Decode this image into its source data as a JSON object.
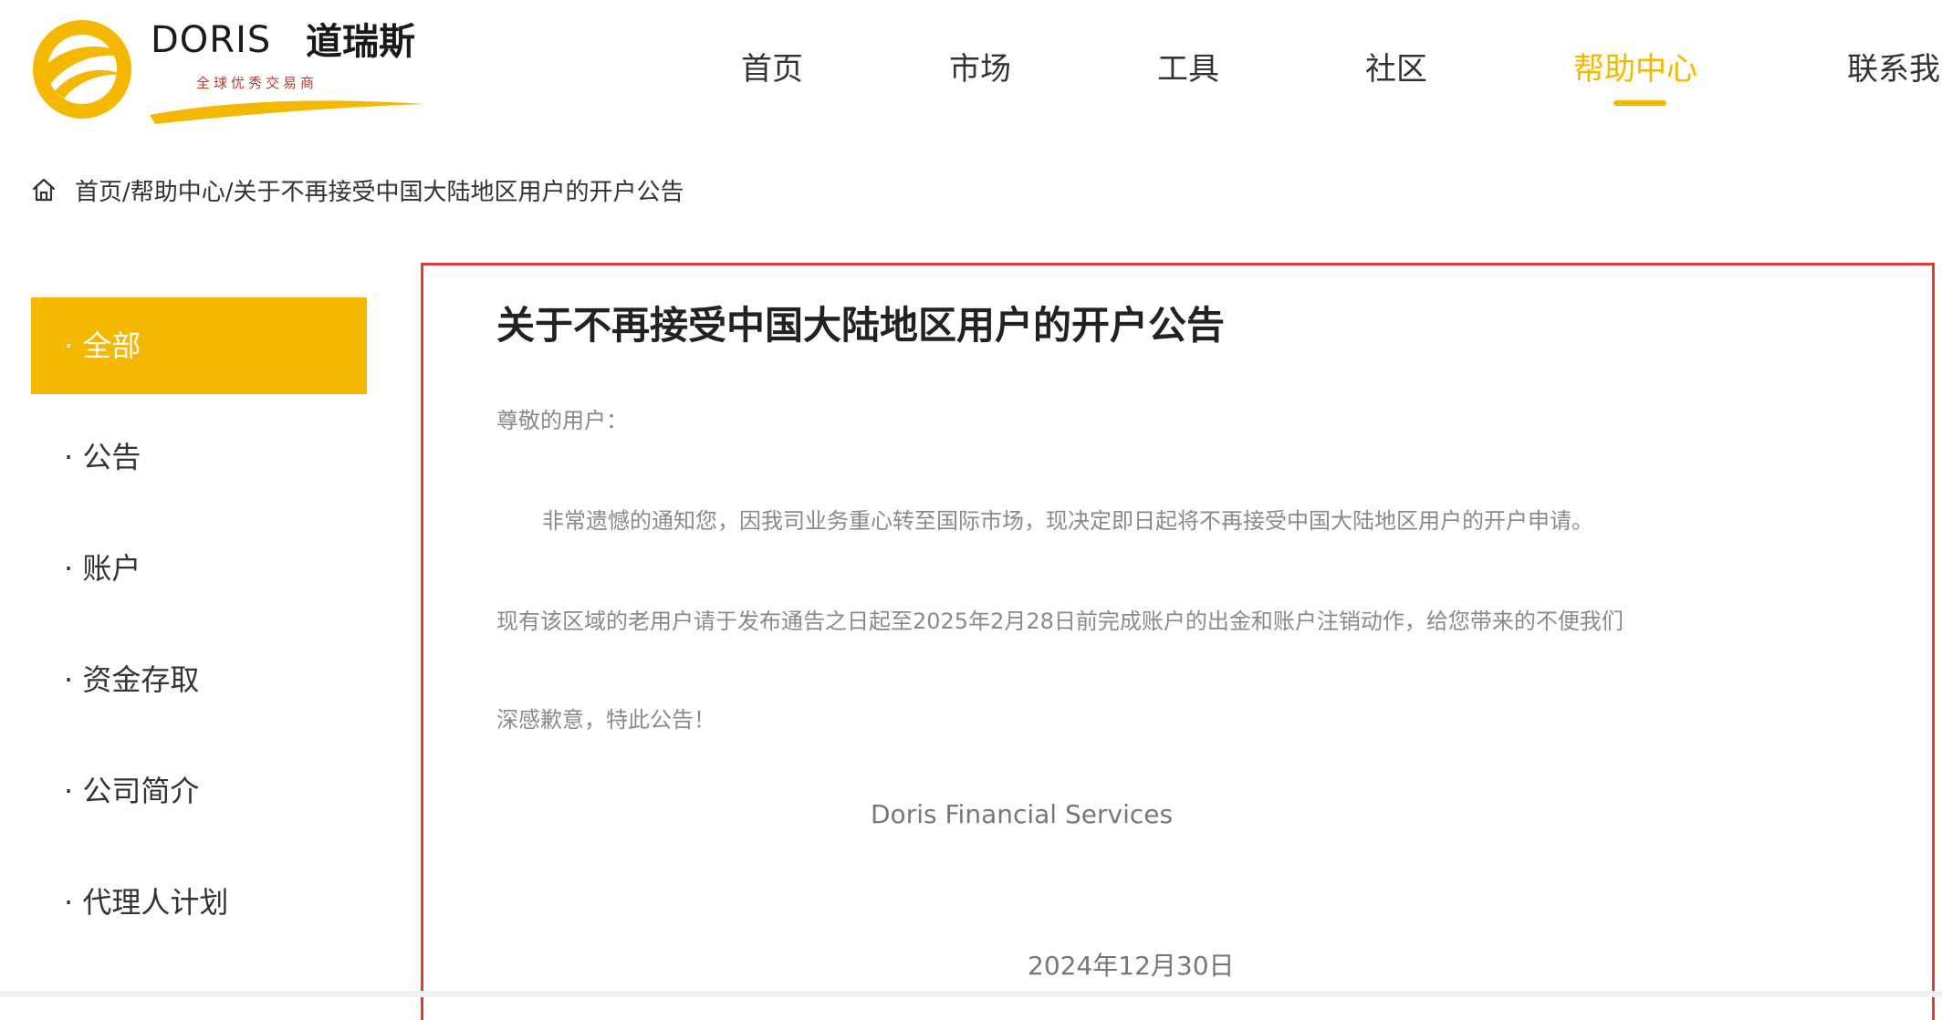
{
  "header": {
    "logo": {
      "name": "DORIS",
      "name_cn": "道瑞斯",
      "slogan": "全球优秀交易商"
    },
    "nav": [
      {
        "label": "首页",
        "active": false
      },
      {
        "label": "市场",
        "active": false
      },
      {
        "label": "工具",
        "active": false
      },
      {
        "label": "社区",
        "active": false
      },
      {
        "label": "帮助中心",
        "active": true
      },
      {
        "label": "联系我"
      }
    ],
    "accent_color": "#f5b800"
  },
  "breadcrumb": {
    "icon": "home-icon",
    "text": "首页/帮助中心/关于不再接受中国大陆地区用户的开户公告"
  },
  "sidebar": {
    "items": [
      {
        "label": "· 全部",
        "active": true
      },
      {
        "label": "· 公告",
        "active": false
      },
      {
        "label": "· 账户",
        "active": false
      },
      {
        "label": "· 资金存取",
        "active": false
      },
      {
        "label": "· 公司简介",
        "active": false
      },
      {
        "label": "· 代理人计划",
        "active": false
      }
    ]
  },
  "article": {
    "title": "关于不再接受中国大陆地区用户的开户公告",
    "greeting": "尊敬的用户：",
    "paragraphs": [
      "非常遗憾的通知您，因我司业务重心转至国际市场，现决定即日起将不再接受中国大陆地区用户的开户申请。",
      "现有该区域的老用户请于发布通告之日起至2025年2月28日前完成账户的出金和账户注销动作，给您带来的不便我们",
      "深感歉意，特此公告！"
    ],
    "signature": "Doris Financial Services",
    "date": "2024年12月30日",
    "highlight_border_color": "#e53935"
  }
}
